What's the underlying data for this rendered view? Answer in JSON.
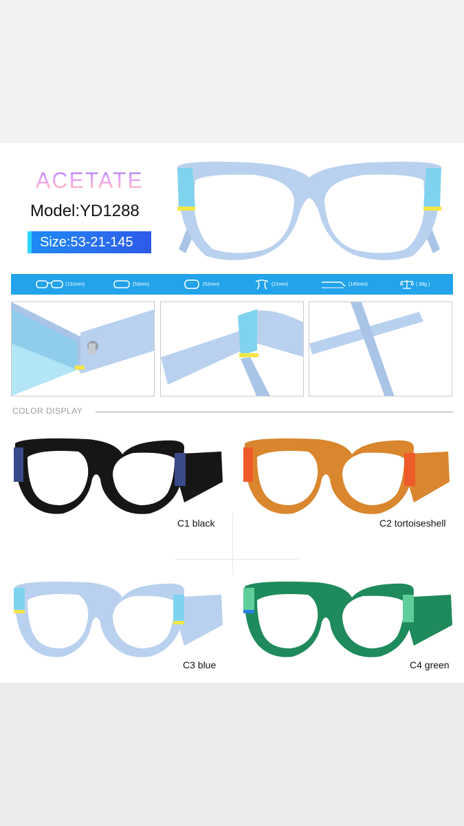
{
  "header": {
    "material": "ACETATE",
    "model": "Model:YD1288",
    "size": "Size:53-21-145"
  },
  "specs": [
    {
      "icon": "frame-width-icon",
      "value": "(131mm)"
    },
    {
      "icon": "lens-width-icon",
      "value": "(53mm)"
    },
    {
      "icon": "lens-height-icon",
      "value": "(52mm)"
    },
    {
      "icon": "bridge-icon",
      "value": "(21mm)"
    },
    {
      "icon": "temple-length-icon",
      "value": "(145mm)"
    },
    {
      "icon": "weight-scale-icon",
      "value": "( 39g )"
    }
  ],
  "section_title": "COLOR DISPLAY",
  "colors": [
    {
      "code": "C1 black",
      "frame": "#161616",
      "accent": "#3a4a8a"
    },
    {
      "code": "C2 tortoiseshell",
      "frame": "#d9862e",
      "accent": "#ef5a2a"
    },
    {
      "code": "C3 blue",
      "frame": "#b9d1ee",
      "accent": "#7fd3ef"
    },
    {
      "code": "C4 green",
      "frame": "#1f8a5c",
      "accent": "#5fcf9a"
    }
  ],
  "palette": {
    "spec_bar": "#22a3ea",
    "size_box": "#2a6ef0",
    "frame_blue": "#b9d1ee",
    "accent_blue": "#7fd3ef",
    "stripe_yellow": "#f2e64a"
  }
}
